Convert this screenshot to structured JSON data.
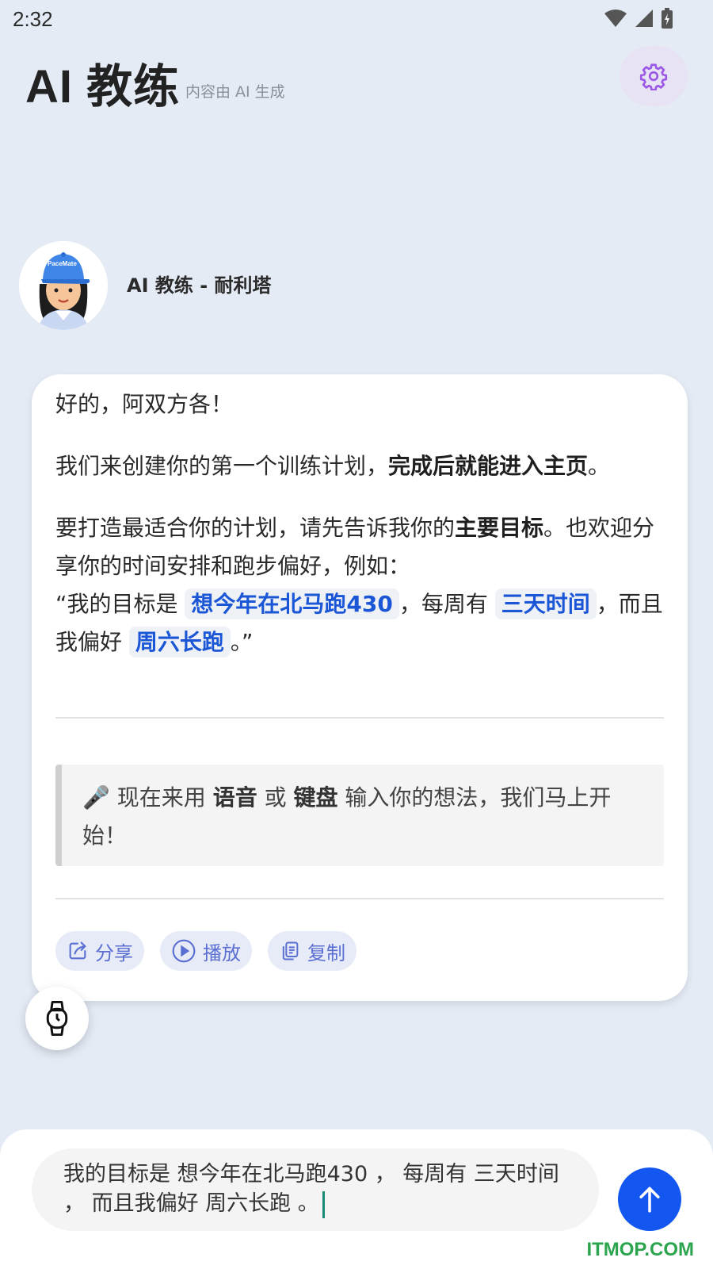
{
  "status_bar": {
    "time": "2:32"
  },
  "header": {
    "title": "AI 教练",
    "ai_note": "内容由 AI 生成",
    "settings_icon": "gear-icon",
    "accent": "#9b59e6"
  },
  "coach": {
    "name": "AI 教练 - 耐利塔",
    "cap_text": "PaceMate"
  },
  "message": {
    "greeting": "好的，阿双方各！",
    "p2_text": "我们来创建你的第一个训练计划，",
    "p2_bold": "完成后就能进入主页",
    "p2_end": "。",
    "p3_text": "要打造最适合你的计划，请先告诉我你的",
    "p3_bold": "主要目标",
    "p3_end": "。也欢迎分享你的时间安排和跑步偏好，例如：",
    "ex_open": "“我的目标是 ",
    "ex_chip1": "想今年在北马跑430",
    "ex_mid1": "，每周有 ",
    "ex_chip2": "三天时间",
    "ex_mid2": "，而且我偏好 ",
    "ex_chip3": "周六长跑",
    "ex_close": "。”",
    "tip_emoji": "🎤",
    "tip_pre": " 现在来用 ",
    "tip_bold1": "语音",
    "tip_mid": " 或 ",
    "tip_bold2": "键盘",
    "tip_post": " 输入你的想法，我们马上开始！"
  },
  "actions": {
    "share": "分享",
    "play": "播放",
    "copy": "复制"
  },
  "composer": {
    "input_value": "我的目标是 想今年在北马跑430 ， 每周有 三天时间 ， 而且我偏好 周六长跑 。"
  },
  "colors": {
    "background": "#e4ebf5",
    "chip_text": "#1a56d6",
    "send_button": "#1356f0",
    "action_text": "#5a6fd1"
  },
  "watermark": "ITMOP.COM"
}
